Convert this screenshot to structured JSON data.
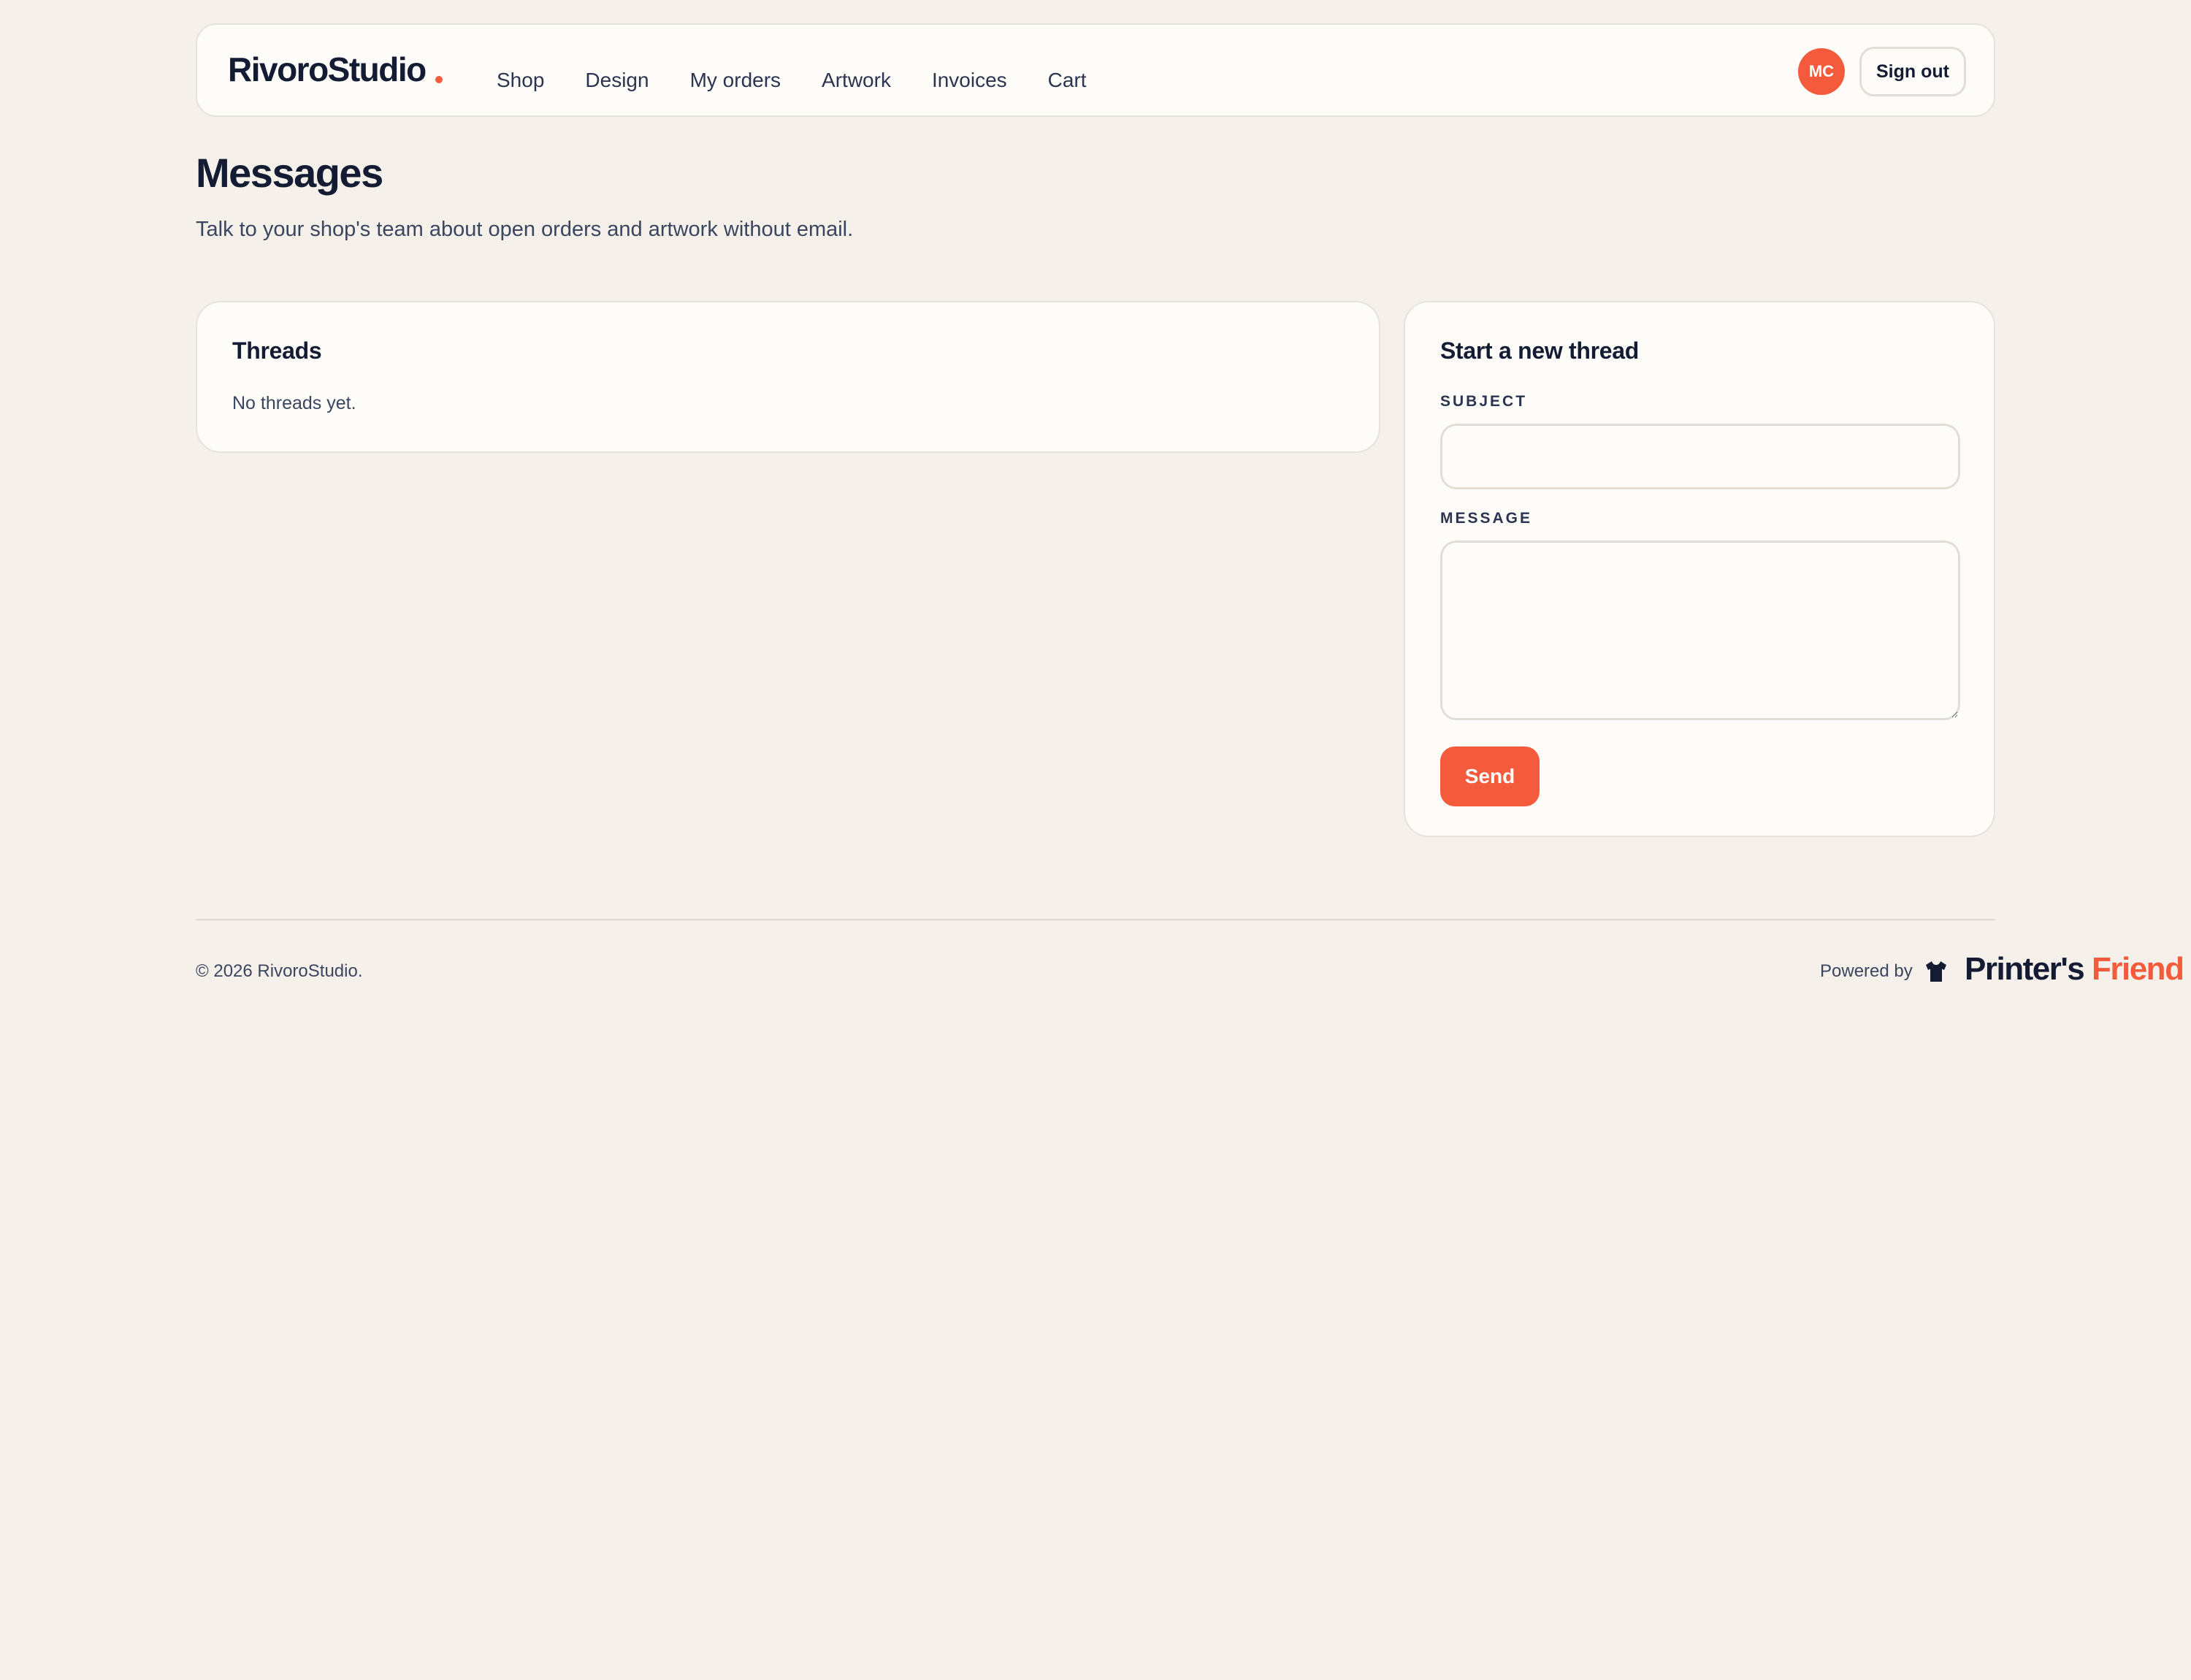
{
  "header": {
    "brand": "RivoroStudio",
    "nav": [
      "Shop",
      "Design",
      "My orders",
      "Artwork",
      "Invoices",
      "Cart"
    ],
    "avatar_initials": "MC",
    "sign_out": "Sign out"
  },
  "page": {
    "title": "Messages",
    "subtitle": "Talk to your shop's team about open orders and artwork without email."
  },
  "threads": {
    "title": "Threads",
    "empty": "No threads yet."
  },
  "new_thread": {
    "title": "Start a new thread",
    "subject_label": "SUBJECT",
    "subject_value": "",
    "message_label": "MESSAGE",
    "message_value": "",
    "send": "Send"
  },
  "footer": {
    "copyright": "© 2026 RivoroStudio.",
    "powered_by": "Powered by",
    "logo_part1": "Printer's",
    "logo_part2": " Friend"
  },
  "colors": {
    "accent": "#f35b3c",
    "background": "#f5f1ea",
    "card": "#fdfcf8",
    "text": "#131c33"
  },
  "icons": [
    "shirt-icon"
  ]
}
